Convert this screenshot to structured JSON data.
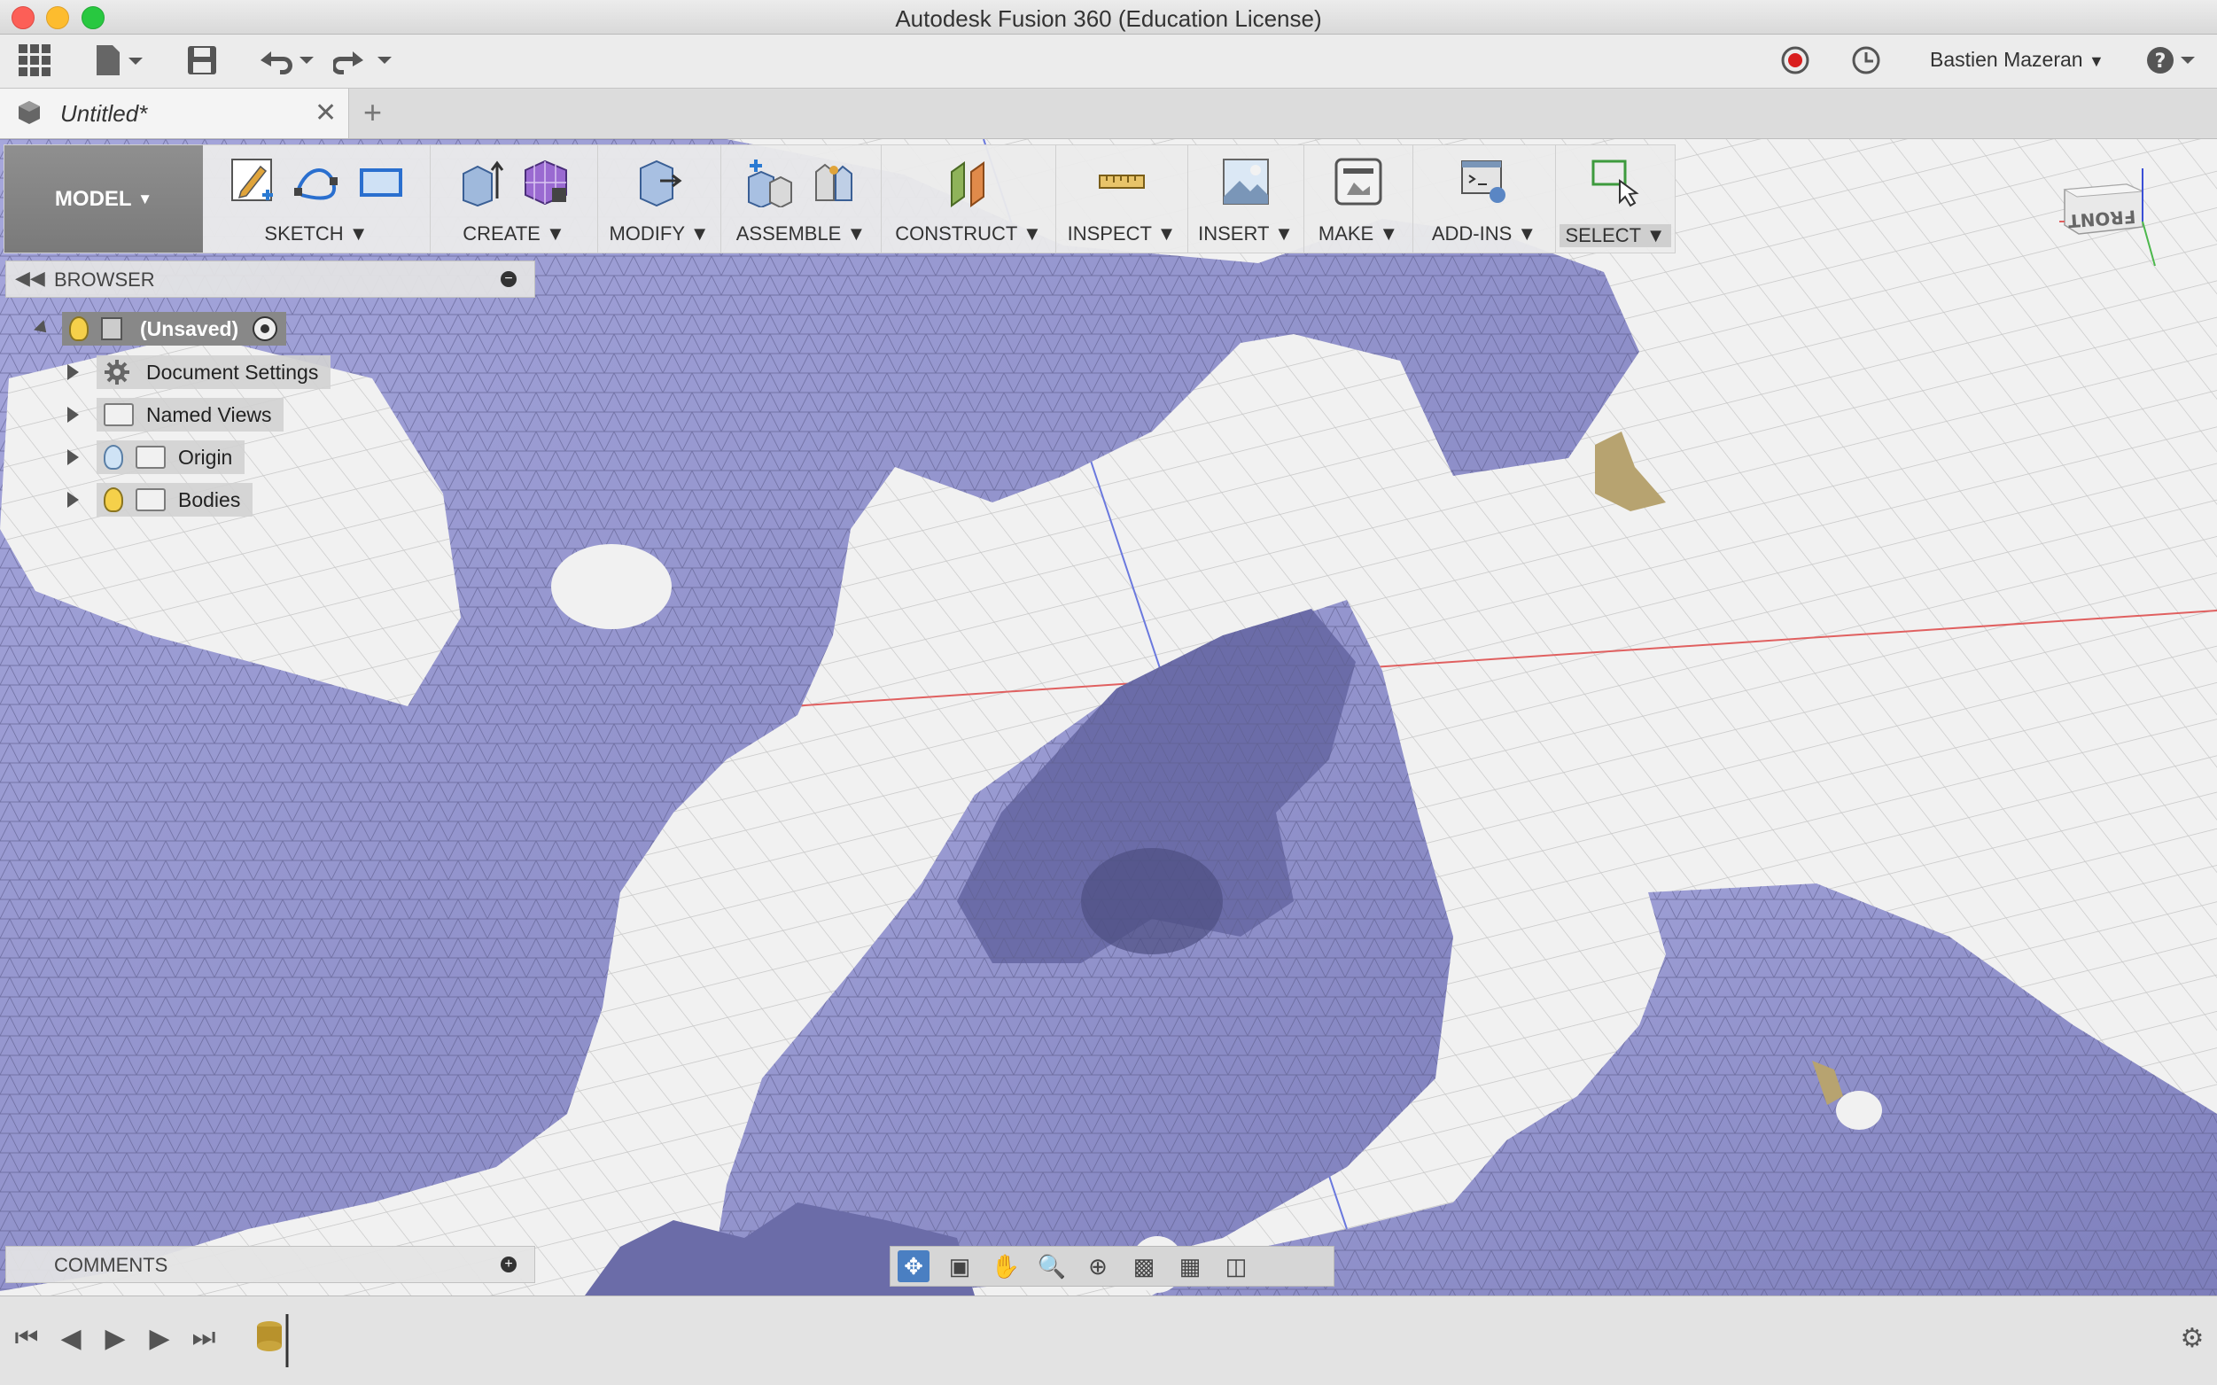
{
  "window": {
    "title": "Autodesk Fusion 360 (Education License)"
  },
  "qab": {
    "user": "Bastien Mazeran"
  },
  "tabs": [
    {
      "label": "Untitled*"
    }
  ],
  "toolbar": {
    "workspace": "MODEL",
    "groups": [
      {
        "label": "SKETCH"
      },
      {
        "label": "CREATE"
      },
      {
        "label": "MODIFY"
      },
      {
        "label": "ASSEMBLE"
      },
      {
        "label": "CONSTRUCT"
      },
      {
        "label": "INSPECT"
      },
      {
        "label": "INSERT"
      },
      {
        "label": "MAKE"
      },
      {
        "label": "ADD-INS"
      },
      {
        "label": "SELECT"
      }
    ]
  },
  "browser": {
    "title": "BROWSER",
    "root": "(Unsaved)",
    "items": [
      {
        "label": "Document Settings"
      },
      {
        "label": "Named Views"
      },
      {
        "label": "Origin"
      },
      {
        "label": "Bodies"
      }
    ]
  },
  "comments": {
    "title": "COMMENTS"
  },
  "viewcube": {
    "face": "FRONT"
  },
  "colors": {
    "mesh": "#8f90c9",
    "accent": "#4a7fc2",
    "record": "#d91e1e"
  }
}
